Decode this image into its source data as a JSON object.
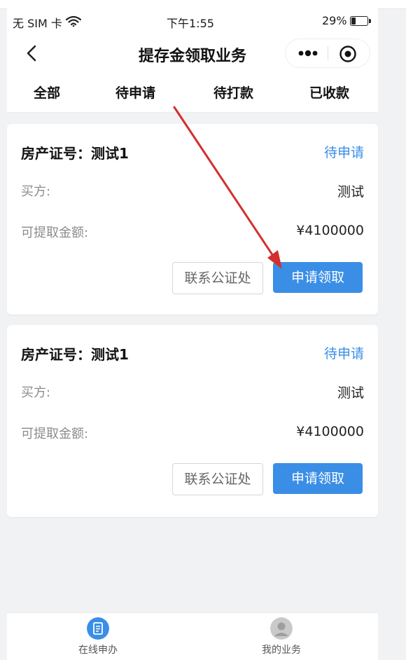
{
  "status_bar": {
    "carrier": "无 SIM 卡",
    "time": "下午1:55",
    "battery": "29%"
  },
  "nav": {
    "title": "提存金领取业务"
  },
  "tabs": [
    {
      "label": "全部"
    },
    {
      "label": "待申请"
    },
    {
      "label": "待打款"
    },
    {
      "label": "已收款"
    }
  ],
  "cards": [
    {
      "cert": "房产证号：测试1",
      "status": "待申请",
      "buyer_label": "买方:",
      "buyer_value": "测试",
      "amount_label": "可提取金额:",
      "amount_value": "¥4100000",
      "contact_button": "联系公证处",
      "apply_button": "申请领取"
    },
    {
      "cert": "房产证号：测试1",
      "status": "待申请",
      "buyer_label": "买方:",
      "buyer_value": "测试",
      "amount_label": "可提取金额:",
      "amount_value": "¥4100000",
      "contact_button": "联系公证处",
      "apply_button": "申请领取"
    }
  ],
  "bottom_nav": [
    {
      "label": "在线申办",
      "icon": "document-icon"
    },
    {
      "label": "我的业务",
      "icon": "user-avatar-icon"
    }
  ],
  "colors": {
    "accent": "#3a8ee6",
    "arrow": "#d32f2f"
  }
}
